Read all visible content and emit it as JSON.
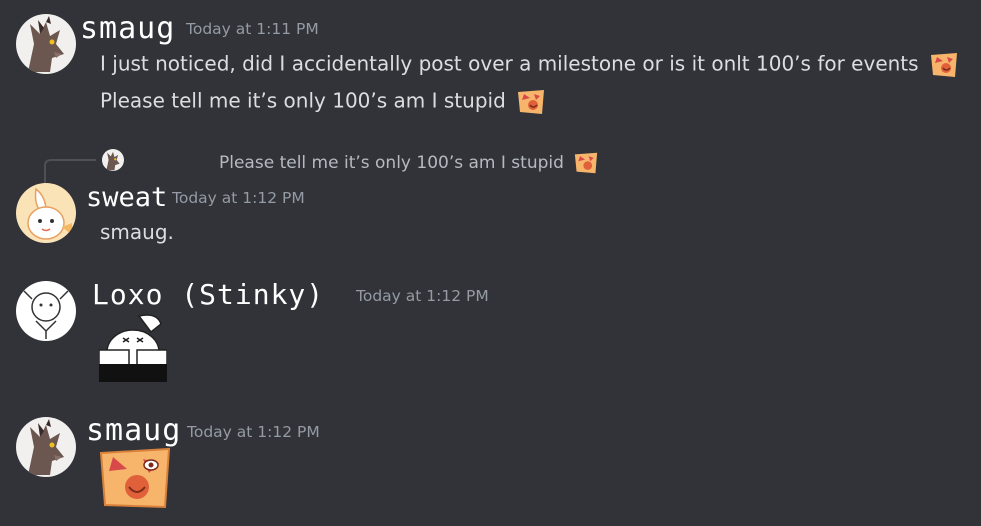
{
  "messages": [
    {
      "author": "smaug",
      "timestamp": "Today at 1:11 PM",
      "lines": [
        "I just noticed, did I accidentally post over a milestone or is it onlt 100’s for events",
        "Please tell me it’s only 100’s am I stupid"
      ],
      "emoji": "panic-face-emoji"
    },
    {
      "reply_to": {
        "author_avatar": "smaug-avatar",
        "text": "Please tell me it’s only 100’s am I stupid"
      },
      "author": "sweat",
      "timestamp": "Today at 1:12 PM",
      "lines": [
        "smaug."
      ]
    },
    {
      "author": "Loxo (Stinky)",
      "timestamp": "Today at 1:12 PM",
      "sticker": "bunny-facepalm-sticker"
    },
    {
      "author": "smaug",
      "timestamp": "Today at 1:12 PM",
      "sticker": "panic-face-emoji-large"
    }
  ],
  "colors": {
    "background": "#313338",
    "text": "#dbdee1",
    "timestamp": "#949ba4",
    "username": "#ffffff"
  }
}
